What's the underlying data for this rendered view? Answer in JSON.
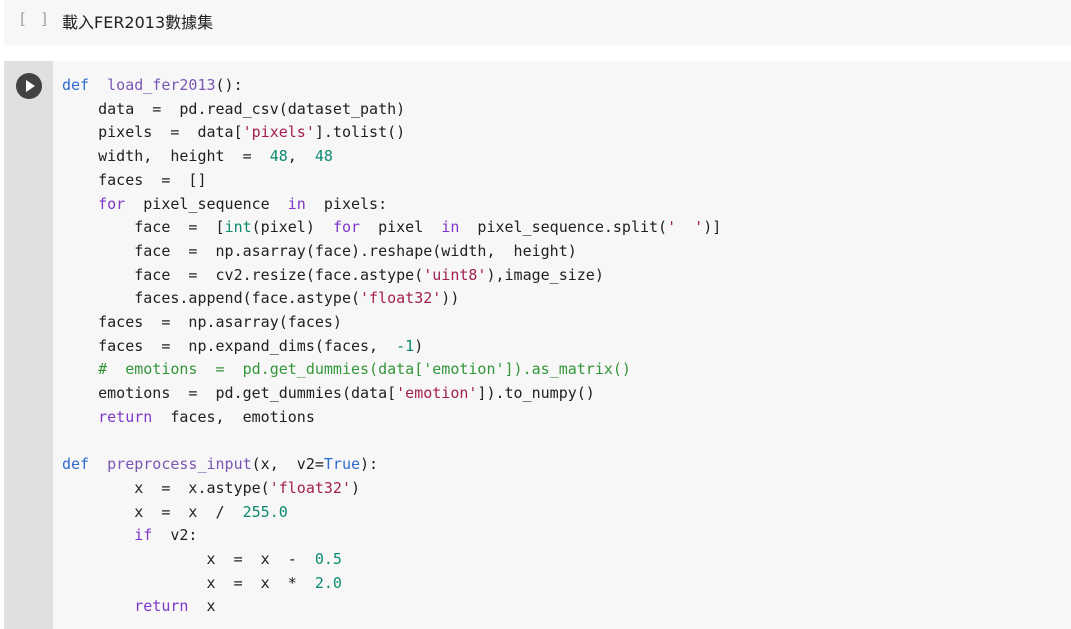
{
  "text_cell": {
    "bracket": "[ ]",
    "title": "載入FER2013數據集"
  },
  "code_cell": {
    "run_icon": "play-icon",
    "lines": [
      [
        {
          "t": "def",
          "c": "kw2"
        },
        {
          "t": "  "
        },
        {
          "t": "load_fer2013",
          "c": "fn"
        },
        {
          "t": "():"
        }
      ],
      [
        {
          "t": "    data  =  pd.read_csv(dataset_path)"
        }
      ],
      [
        {
          "t": "    pixels  =  data["
        },
        {
          "t": "'pixels'",
          "c": "str"
        },
        {
          "t": "].tolist()"
        }
      ],
      [
        {
          "t": "    width,  height  =  "
        },
        {
          "t": "48",
          "c": "num"
        },
        {
          "t": ",  "
        },
        {
          "t": "48",
          "c": "num"
        }
      ],
      [
        {
          "t": "    faces  =  []"
        }
      ],
      [
        {
          "t": "    "
        },
        {
          "t": "for",
          "c": "kw"
        },
        {
          "t": "  pixel_sequence  "
        },
        {
          "t": "in",
          "c": "kw"
        },
        {
          "t": "  pixels:"
        }
      ],
      [
        {
          "t": "        face  =  ["
        },
        {
          "t": "int",
          "c": "cls"
        },
        {
          "t": "(pixel)  "
        },
        {
          "t": "for",
          "c": "kw"
        },
        {
          "t": "  pixel  "
        },
        {
          "t": "in",
          "c": "kw"
        },
        {
          "t": "  pixel_sequence.split("
        },
        {
          "t": "'  '",
          "c": "str"
        },
        {
          "t": ")]"
        }
      ],
      [
        {
          "t": "        face  =  np.asarray(face).reshape(width,  height)"
        }
      ],
      [
        {
          "t": "        face  =  cv2.resize(face.astype("
        },
        {
          "t": "'uint8'",
          "c": "str"
        },
        {
          "t": "),image_size)"
        }
      ],
      [
        {
          "t": "        faces.append(face.astype("
        },
        {
          "t": "'float32'",
          "c": "str"
        },
        {
          "t": "))"
        }
      ],
      [
        {
          "t": "    faces  =  np.asarray(faces)"
        }
      ],
      [
        {
          "t": "    faces  =  np.expand_dims(faces,  "
        },
        {
          "t": "-1",
          "c": "num"
        },
        {
          "t": ")"
        }
      ],
      [
        {
          "t": "    #  emotions  =  pd.get_dummies(data['emotion']).as_matrix()",
          "c": "cm"
        }
      ],
      [
        {
          "t": "    emotions  =  pd.get_dummies(data["
        },
        {
          "t": "'emotion'",
          "c": "str"
        },
        {
          "t": "]).to_numpy()"
        }
      ],
      [
        {
          "t": "    "
        },
        {
          "t": "return",
          "c": "kw"
        },
        {
          "t": "  faces,  emotions"
        }
      ],
      [],
      [
        {
          "t": "def",
          "c": "kw2"
        },
        {
          "t": "  "
        },
        {
          "t": "preprocess_input",
          "c": "fn"
        },
        {
          "t": "(x,  v2="
        },
        {
          "t": "True",
          "c": "kw2"
        },
        {
          "t": "):"
        }
      ],
      [
        {
          "t": "        x  =  x.astype("
        },
        {
          "t": "'float32'",
          "c": "str"
        },
        {
          "t": ")"
        }
      ],
      [
        {
          "t": "        x  =  x  /  "
        },
        {
          "t": "255.0",
          "c": "num"
        }
      ],
      [
        {
          "t": "        "
        },
        {
          "t": "if",
          "c": "kw"
        },
        {
          "t": "  v2:"
        }
      ],
      [
        {
          "t": "                x  =  x  -  "
        },
        {
          "t": "0.5",
          "c": "num"
        }
      ],
      [
        {
          "t": "                x  =  x  *  "
        },
        {
          "t": "2.0",
          "c": "num"
        }
      ],
      [
        {
          "t": "        "
        },
        {
          "t": "return",
          "c": "kw"
        },
        {
          "t": "  x"
        }
      ]
    ]
  }
}
